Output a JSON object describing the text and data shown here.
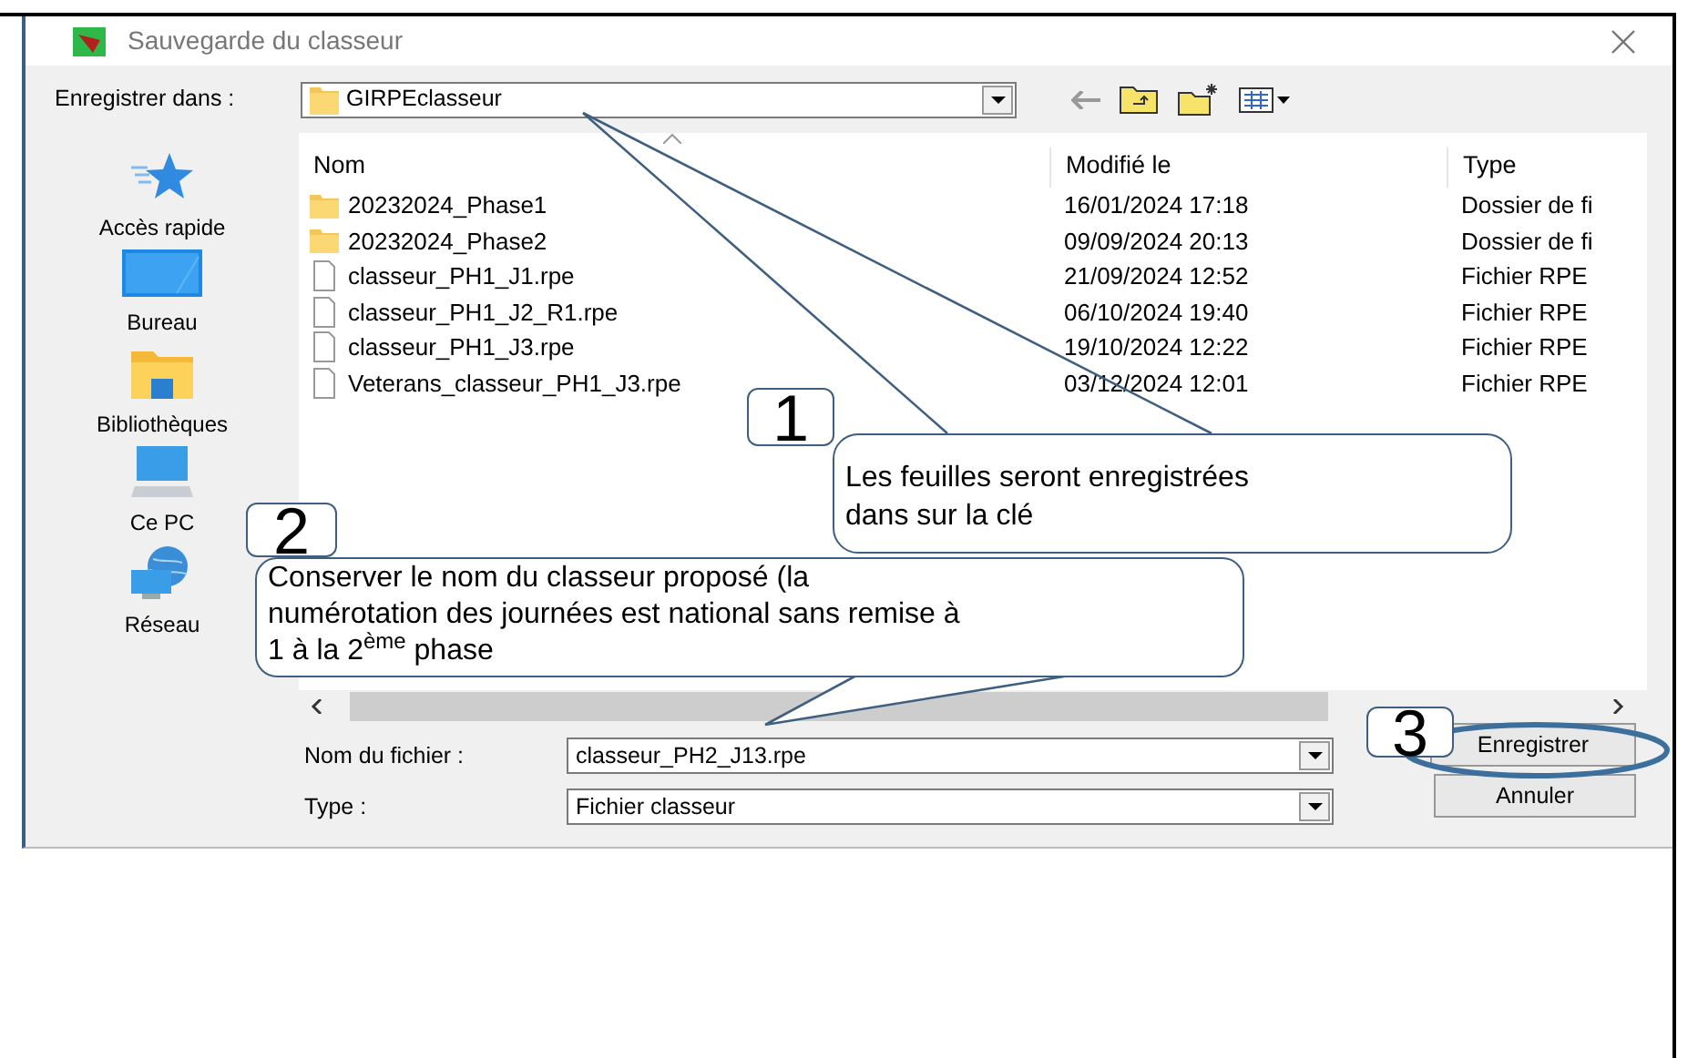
{
  "window": {
    "title": "Sauvegarde du classeur"
  },
  "save_in": {
    "label": "Enregistrer dans :",
    "value": "GIRPEclasseur"
  },
  "places": [
    {
      "label": "Accès rapide",
      "kind": "star"
    },
    {
      "label": "Bureau",
      "kind": "desktop"
    },
    {
      "label": "Bibliothèques",
      "kind": "library"
    },
    {
      "label": "Ce PC",
      "kind": "computer"
    },
    {
      "label": "Réseau",
      "kind": "network"
    }
  ],
  "file_list": {
    "columns": [
      "Nom",
      "Modifié le",
      "Type"
    ],
    "rows": [
      {
        "kind": "folder",
        "name": "20232024_Phase1",
        "modified": "16/01/2024 17:18",
        "type": "Dossier de fi"
      },
      {
        "kind": "folder",
        "name": "20232024_Phase2",
        "modified": "09/09/2024 20:13",
        "type": "Dossier de fi"
      },
      {
        "kind": "file",
        "name": "classeur_PH1_J1.rpe",
        "modified": "21/09/2024 12:52",
        "type": "Fichier RPE"
      },
      {
        "kind": "file",
        "name": "classeur_PH1_J2_R1.rpe",
        "modified": "06/10/2024 19:40",
        "type": "Fichier RPE"
      },
      {
        "kind": "file",
        "name": "classeur_PH1_J3.rpe",
        "modified": "19/10/2024 12:22",
        "type": "Fichier RPE"
      },
      {
        "kind": "file",
        "name": "Veterans_classeur_PH1_J3.rpe",
        "modified": "03/12/2024 12:01",
        "type": "Fichier RPE"
      }
    ]
  },
  "file_name": {
    "label": "Nom du fichier :",
    "value": "classeur_PH2_J13.rpe"
  },
  "file_type": {
    "label": "Type :",
    "value": "Fichier classeur"
  },
  "buttons": [
    "Enregistrer",
    "Annuler"
  ],
  "annotations": [
    {
      "number": "1",
      "text": "Les feuilles seront enregistrées\ndans sur la clé"
    },
    {
      "number": "2",
      "text": "Conserver le nom du classeur proposé (la\nnumérotation des journées est national sans remise à\n1 à la 2$^{ème}$ phase"
    },
    {
      "number": "3"
    }
  ]
}
